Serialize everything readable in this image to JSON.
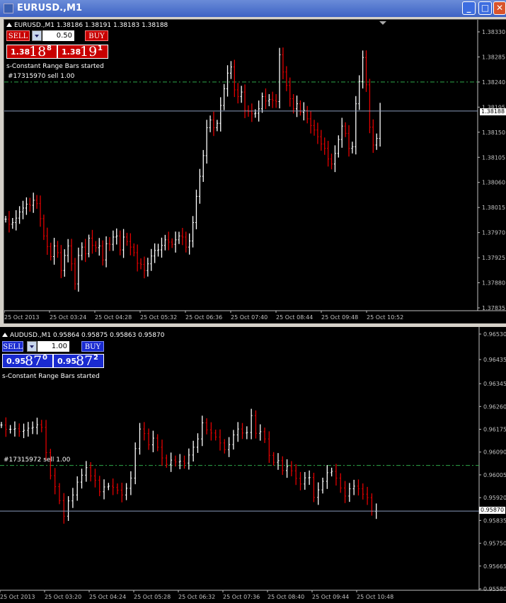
{
  "window": {
    "title": "EURUSD.,M1",
    "buttons": {
      "minimize": "_",
      "maximize": "□",
      "close": "✕"
    }
  },
  "colors": {
    "background": "#000000",
    "bull": "#ffffff",
    "bear": "#e00000",
    "grid_axis": "#c0c0c0",
    "bid_line": "#8a9bbd",
    "order_line": "#2fa84a",
    "eur_panel": "#c80000",
    "aud_panel": "#1a2bd0"
  },
  "eurusd": {
    "symbol_line": "EURUSD.,M1  1.38186 1.38191 1.38183 1.38188",
    "trade": {
      "sell_label": "SELL",
      "buy_label": "BUY",
      "lot": "0.50",
      "sell_pre": "1.38",
      "sell_big": "18",
      "sell_sup": "8",
      "buy_pre": "1.38",
      "buy_big": "19",
      "buy_sup": "1"
    },
    "status": "s-Constant Range Bars started",
    "order_label": "#17315970 sell 1.00",
    "current_price": "1.38188",
    "order_price": 1.3824,
    "y_ticks": [
      "1.38330",
      "1.38285",
      "1.38240",
      "1.38195",
      "1.38150",
      "1.38105",
      "1.38060",
      "1.38015",
      "1.37970",
      "1.37925",
      "1.37880",
      "1.37835"
    ],
    "x_ticks": [
      "25 Oct 2013",
      "25 Oct 03:24",
      "25 Oct 04:28",
      "25 Oct 05:32",
      "25 Oct 06:36",
      "25 Oct 07:40",
      "25 Oct 08:44",
      "25 Oct 09:48",
      "25 Oct 10:52"
    ],
    "closes": [
      1.37994,
      1.37985,
      1.37988,
      1.37996,
      1.38007,
      1.38014,
      1.38021,
      1.38019,
      1.38028,
      1.38022,
      1.37995,
      1.37964,
      1.37945,
      1.37927,
      1.37946,
      1.37934,
      1.37902,
      1.37929,
      1.37946,
      1.37914,
      1.37878,
      1.37929,
      1.37944,
      1.37932,
      1.3796,
      1.37947,
      1.37943,
      1.37946,
      1.37921,
      1.3795,
      1.37949,
      1.37962,
      1.37964,
      1.37939,
      1.37962,
      1.37954,
      1.37944,
      1.37934,
      1.37915,
      1.37913,
      1.37902,
      1.37914,
      1.37928,
      1.37938,
      1.37939,
      1.37947,
      1.37957,
      1.37953,
      1.37949,
      1.37957,
      1.37964,
      1.37962,
      1.37944,
      1.37955,
      1.37988,
      1.38035,
      1.38071,
      1.38108,
      1.38158,
      1.38172,
      1.38158,
      1.38166,
      1.38198,
      1.38228,
      1.38256,
      1.38267,
      1.38226,
      1.38214,
      1.38222,
      1.38189,
      1.38187,
      1.38183,
      1.38184,
      1.38192,
      1.38214,
      1.38206,
      1.38209,
      1.38207,
      1.38205,
      1.38289,
      1.38258,
      1.38234,
      1.3821,
      1.38192,
      1.38201,
      1.38186,
      1.38189,
      1.38174,
      1.38162,
      1.38154,
      1.38142,
      1.38129,
      1.38121,
      1.38102,
      1.38093,
      1.38112,
      1.38137,
      1.38161,
      1.38148,
      1.38121,
      1.38124,
      1.38201,
      1.38241,
      1.38284,
      1.38235,
      1.38159,
      1.38127,
      1.38139,
      1.38188
    ]
  },
  "audusd": {
    "symbol_line": "AUDUSD.,M1  0.95864 0.95875 0.95863 0.95870",
    "trade": {
      "sell_label": "SELL",
      "buy_label": "BUY",
      "lot": "1.00",
      "sell_pre": "0.95",
      "sell_big": "87",
      "sell_sup": "0",
      "buy_pre": "0.95",
      "buy_big": "87",
      "buy_sup": "2"
    },
    "status": "s-Constant Range Bars started",
    "order_label": "#17315972 sell 1.00",
    "current_price": "0.95870",
    "order_price": 0.9604,
    "y_ticks": [
      "0.96530",
      "0.96435",
      "0.96345",
      "0.96260",
      "0.96175",
      "0.96090",
      "0.96005",
      "0.95920",
      "0.95835",
      "0.95750",
      "0.95665",
      "0.95580"
    ],
    "x_ticks": [
      "25 Oct 2013",
      "25 Oct 03:20",
      "25 Oct 04:24",
      "25 Oct 05:28",
      "25 Oct 06:32",
      "25 Oct 07:36",
      "25 Oct 08:40",
      "25 Oct 09:44",
      "25 Oct 10:48"
    ],
    "closes": [
      0.96191,
      0.96175,
      0.96175,
      0.96177,
      0.96167,
      0.96171,
      0.96179,
      0.96182,
      0.96192,
      0.96182,
      0.96088,
      0.96002,
      0.95961,
      0.95909,
      0.95851,
      0.95908,
      0.9593,
      0.95978,
      0.96004,
      0.96032,
      0.96001,
      0.95985,
      0.95942,
      0.9596,
      0.95963,
      0.95958,
      0.95948,
      0.9593,
      0.95955,
      0.95993,
      0.96103,
      0.96176,
      0.96159,
      0.96117,
      0.96142,
      0.96108,
      0.96068,
      0.96044,
      0.9606,
      0.96053,
      0.96056,
      0.96049,
      0.96079,
      0.96108,
      0.96139,
      0.96199,
      0.96173,
      0.96161,
      0.96146,
      0.96124,
      0.96099,
      0.96118,
      0.96154,
      0.96176,
      0.96161,
      0.96163,
      0.96226,
      0.9616,
      0.96166,
      0.96139,
      0.96078,
      0.96052,
      0.96058,
      0.96021,
      0.96036,
      0.9602,
      0.95992,
      0.95971,
      0.95994,
      0.95995,
      0.95921,
      0.95949,
      0.95981,
      0.96013,
      0.96018,
      0.95993,
      0.95956,
      0.95926,
      0.95953,
      0.95963,
      0.95953,
      0.95933,
      0.9592,
      0.95869,
      0.9587
    ]
  }
}
